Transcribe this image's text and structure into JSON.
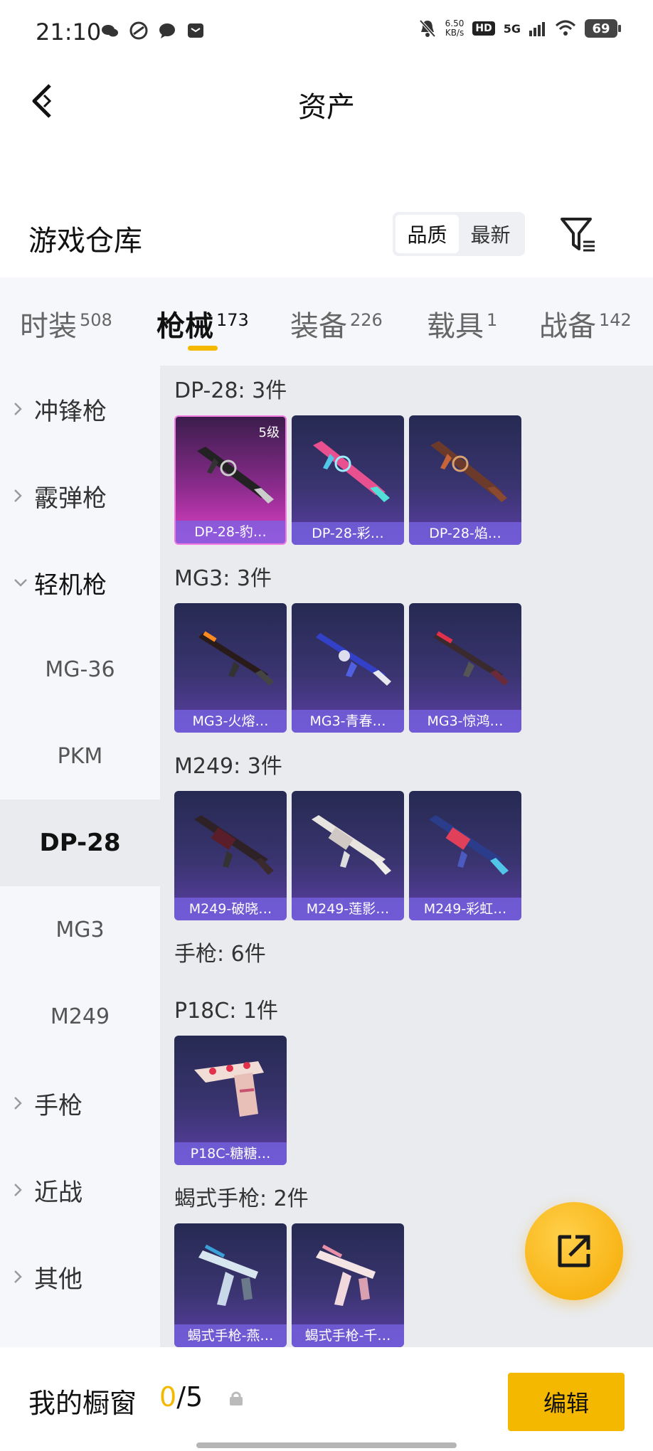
{
  "status_bar": {
    "time": "21:10",
    "net_speed_value": "6.50",
    "net_speed_unit": "KB/s",
    "hd": "HD",
    "network": "5G",
    "battery": "69",
    "icons_left": [
      "wechat-icon",
      "link-icon",
      "chat-bubble-icon",
      "mail-icon"
    ],
    "icons_right": [
      "mute-bell-icon",
      "signal-icon",
      "wifi-icon",
      "battery-icon"
    ]
  },
  "header": {
    "title": "资产",
    "back_icon": "back-arrow-icon"
  },
  "warehouse": {
    "title": "游戏仓库",
    "sort_options": [
      "品质",
      "最新"
    ],
    "sort_selected": "品质",
    "filter_icon": "filter-icon"
  },
  "category_tabs": [
    {
      "label": "时装",
      "count": "508"
    },
    {
      "label": "枪械",
      "count": "173",
      "active": true
    },
    {
      "label": "装备",
      "count": "226"
    },
    {
      "label": "载具",
      "count": "1"
    },
    {
      "label": "战备",
      "count": "142"
    }
  ],
  "side_nav": [
    {
      "label": "冲锋枪",
      "type": "category",
      "expanded": false
    },
    {
      "label": "霰弹枪",
      "type": "category",
      "expanded": false
    },
    {
      "label": "轻机枪",
      "type": "category",
      "expanded": true
    },
    {
      "label": "MG-36",
      "type": "sub"
    },
    {
      "label": "PKM",
      "type": "sub"
    },
    {
      "label": "DP-28",
      "type": "sub",
      "selected": true
    },
    {
      "label": "MG3",
      "type": "sub"
    },
    {
      "label": "M249",
      "type": "sub"
    },
    {
      "label": "手枪",
      "type": "category",
      "expanded": false
    },
    {
      "label": "近战",
      "type": "category",
      "expanded": false
    },
    {
      "label": "其他",
      "type": "category",
      "expanded": false
    }
  ],
  "groups": [
    {
      "title": "DP-28: 3件",
      "items": [
        {
          "label": "DP-28-豹…",
          "level": "5级",
          "rarity": "pink"
        },
        {
          "label": "DP-28-彩…"
        },
        {
          "label": "DP-28-焰…"
        }
      ]
    },
    {
      "title": "MG3: 3件",
      "items": [
        {
          "label": "MG3-火熔…"
        },
        {
          "label": "MG3-青春…"
        },
        {
          "label": "MG3-惊鸿…"
        }
      ]
    },
    {
      "title": "M249: 3件",
      "items": [
        {
          "label": "M249-破晓…"
        },
        {
          "label": "M249-莲影…"
        },
        {
          "label": "M249-彩虹…"
        }
      ]
    },
    {
      "title": "手枪: 6件",
      "items": []
    },
    {
      "title": "P18C: 1件",
      "items": [
        {
          "label": "P18C-糖糖…"
        }
      ]
    },
    {
      "title": "蝎式手枪: 2件",
      "items": [
        {
          "label": "蝎式手枪-燕…"
        },
        {
          "label": "蝎式手枪-千…"
        }
      ]
    }
  ],
  "fab": {
    "icon": "share-external-icon"
  },
  "bottom_bar": {
    "showcase_label": "我的橱窗",
    "showcase_current": "0",
    "showcase_total": "/5",
    "lock_icon": "lock-icon",
    "edit_label": "编辑"
  },
  "colors": {
    "accent": "#f5b800",
    "card_gradient_top": "#262a52",
    "card_gradient_bottom": "#5b3fa6",
    "card_pink": "#e040c6",
    "content_bg": "#e9ebee",
    "sidebar_bg": "#f5f7fa"
  }
}
